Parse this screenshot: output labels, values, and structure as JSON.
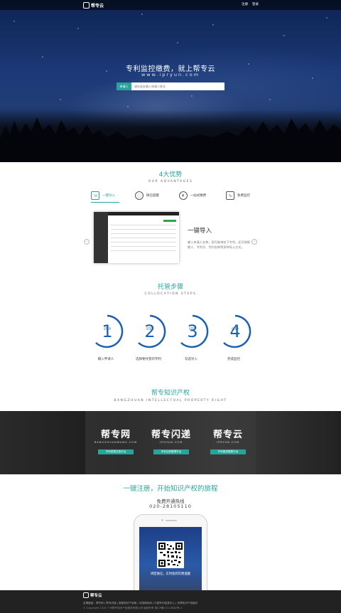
{
  "nav": {
    "logo": "帮专云",
    "links": [
      "注册",
      "登录"
    ]
  },
  "hero": {
    "title": "专利监控缴费，就上帮专云",
    "subtitle": "www.ipryun.com",
    "search_button": "申请人",
    "search_placeholder": "请在此处输入申请人姓名"
  },
  "advantages": {
    "title": "4大优势",
    "subtitle": "OUR ADVANTAGES",
    "tabs": [
      {
        "label": "一键导入",
        "icon": "import-icon"
      },
      {
        "label": "微信提醒",
        "icon": "wechat-icon"
      },
      {
        "label": "一站式缴费",
        "icon": "yen-icon"
      },
      {
        "label": "免费监控",
        "icon": "monitor-icon"
      }
    ],
    "feature_title": "一键导入",
    "feature_desc": "输入申请人名称，即可查询名下专利，还可按照期人、专利号、专利名称等多种导入方式。"
  },
  "steps": {
    "title": "托管步骤",
    "subtitle": "COLLOCATION STEPS",
    "step_word": "STEP",
    "items": [
      {
        "num": "1",
        "label": "输入申请人"
      },
      {
        "num": "2",
        "label": "选择要托管的专利"
      },
      {
        "num": "3",
        "label": "勾选导入"
      },
      {
        "num": "4",
        "label": "完成监控"
      }
    ]
  },
  "ip": {
    "title": "帮专知识产权",
    "subtitle": "BANGZHUAN INTELLECTUAL PROPERTY RIGHT",
    "brands": [
      {
        "name": "帮专网",
        "domain": "BANGZHUANWANG.COM",
        "button": "专利资源交易平台"
      },
      {
        "name": "帮专闪递",
        "domain": "JPSHAN.COM",
        "button": "专利注册管理平台"
      },
      {
        "name": "帮专云",
        "domain": "IPRYUN.COM",
        "button": "专利费用缴费平台"
      }
    ]
  },
  "register": {
    "title": "一键注册，开始知识产权的旅程",
    "hotline_label": "免费开通热线",
    "phone": "020-28105110",
    "qr_text": "绑定微信，实时收到年费提醒"
  },
  "footer": {
    "logo": "帮专云",
    "links": "友情链接：帮专网 | 帮专闪递 | 国家知识产权局 | 中国商标网 | 中国专利信息中心 | 世界知识产权组织",
    "copyright": "© Copyright 2015 广州帮专知识产权服务有限公司 版权所有 粤ICP备15113862号-3"
  },
  "colors": {
    "accent": "#27a59c",
    "step_blue": "#1961b4",
    "footer_bg": "#222222"
  }
}
